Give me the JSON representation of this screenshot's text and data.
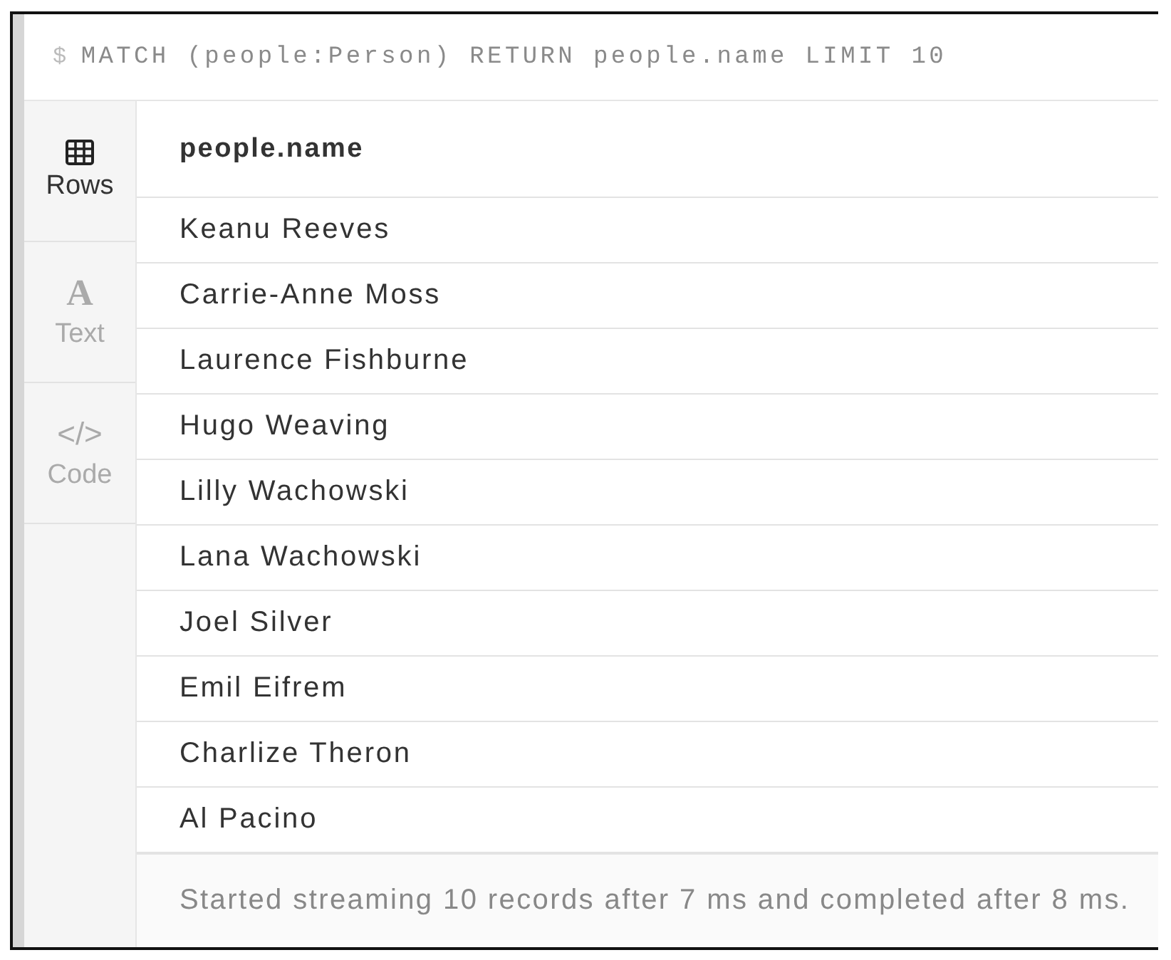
{
  "query": {
    "prompt": "$",
    "text": "MATCH (people:Person) RETURN people.name LIMIT 10"
  },
  "view_tabs": [
    {
      "kind": "rows",
      "label": "Rows",
      "selected": true
    },
    {
      "kind": "text",
      "label": "Text",
      "icon_text": "A",
      "selected": false
    },
    {
      "kind": "code",
      "label": "Code",
      "icon_text": "</>",
      "selected": false
    }
  ],
  "table": {
    "columns": [
      "people.name"
    ],
    "rows": [
      [
        "Keanu Reeves"
      ],
      [
        "Carrie-Anne Moss"
      ],
      [
        "Laurence Fishburne"
      ],
      [
        "Hugo Weaving"
      ],
      [
        "Lilly Wachowski"
      ],
      [
        "Lana Wachowski"
      ],
      [
        "Joel Silver"
      ],
      [
        "Emil Eifrem"
      ],
      [
        "Charlize Theron"
      ],
      [
        "Al Pacino"
      ]
    ]
  },
  "status_bar": "Started streaming 10 records after 7 ms and completed after 8 ms."
}
